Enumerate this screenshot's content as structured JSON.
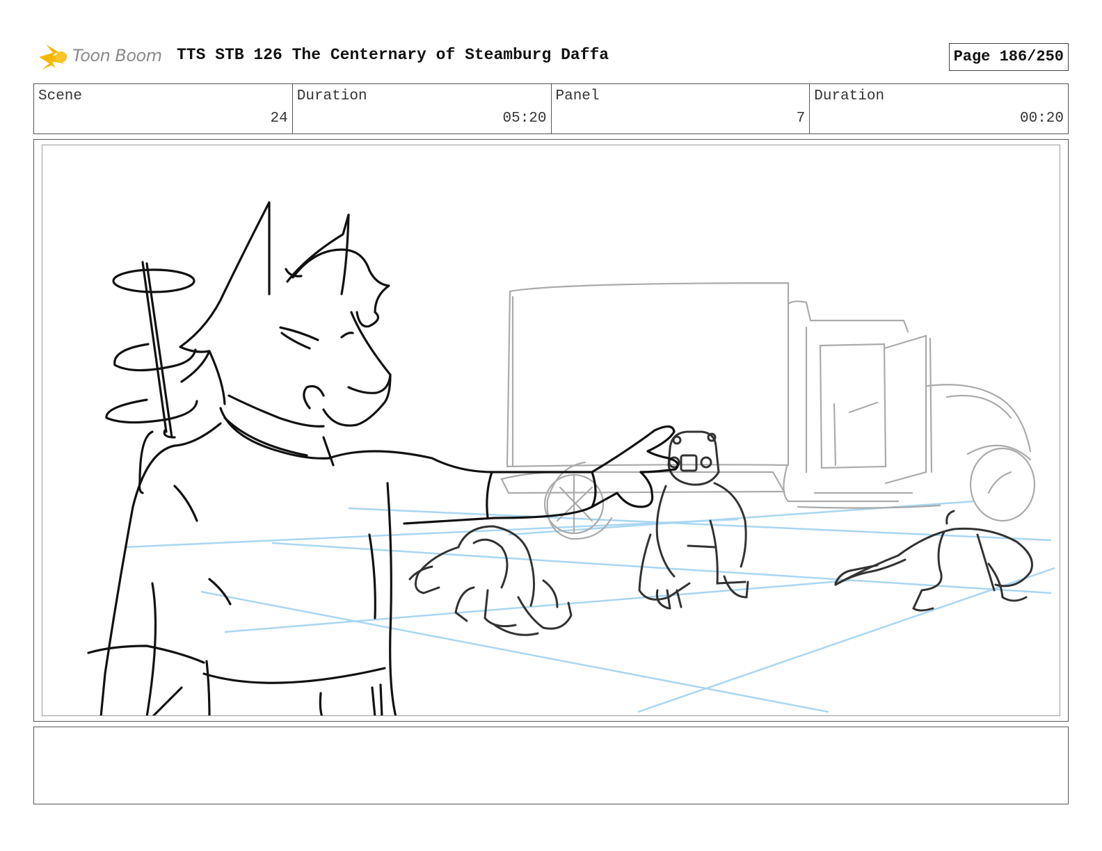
{
  "header": {
    "logo_text": "Toon Boom",
    "title": "TTS STB 126 The Centernary of Steamburg Daffa",
    "page": "Page 186/250"
  },
  "info": {
    "scene_label": "Scene",
    "scene_value": "24",
    "scene_duration_label": "Duration",
    "scene_duration_value": "05:20",
    "panel_label": "Panel",
    "panel_value": "7",
    "panel_duration_label": "Duration",
    "panel_duration_value": "00:20"
  },
  "notes": {
    "text": ""
  },
  "colors": {
    "logo_flame": "#f5b800",
    "sketch_ink": "#111111",
    "background_sketch": "#a8a8a8",
    "perspective_guides": "#9fd0f0"
  }
}
